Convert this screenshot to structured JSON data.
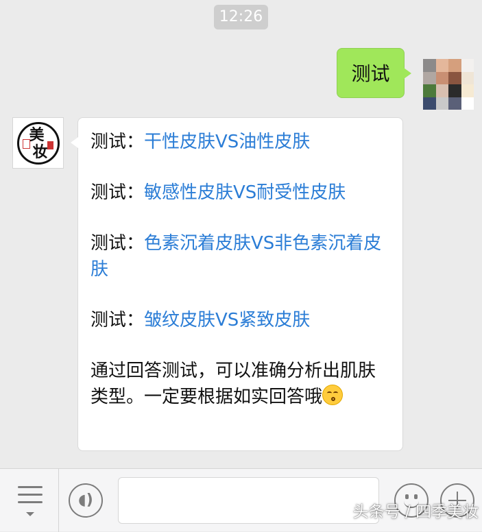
{
  "chat": {
    "timestamp": "12:26",
    "outgoing": {
      "text": "测试"
    },
    "incoming": {
      "avatar": {
        "chars": [
          "美",
          "妆"
        ],
        "seal_left": "四季",
        "seal_right": "美妆"
      },
      "tests": [
        {
          "prefix": "测试：",
          "link": "干性皮肤VS油性皮肤"
        },
        {
          "prefix": "测试：",
          "link": "敏感性皮肤VS耐受性皮肤"
        },
        {
          "prefix": "测试：",
          "link": "色素沉着皮肤VS非色素沉着皮肤"
        },
        {
          "prefix": "测试：",
          "link": "皱纹皮肤VS紧致皮肤"
        }
      ],
      "summary": "通过回答测试，可以准确分析出肌肤类型。一定要根据如实回答哦",
      "summary_emoji": "kissing-face-icon"
    }
  },
  "input_bar": {
    "menu_icon": "menu-list-icon",
    "voice_icon": "voice-icon",
    "voice_glyph": "◖)",
    "input_value": "",
    "emoji_icon": "smiley-icon",
    "plus_icon": "plus-icon"
  },
  "watermark": "头条号 / 四季美妆",
  "colors": {
    "background": "#ebebeb",
    "outgoing_bubble": "#a0e75a",
    "incoming_bubble": "#ffffff",
    "link": "#2b7dd6",
    "timestamp_bg": "#cecece"
  }
}
